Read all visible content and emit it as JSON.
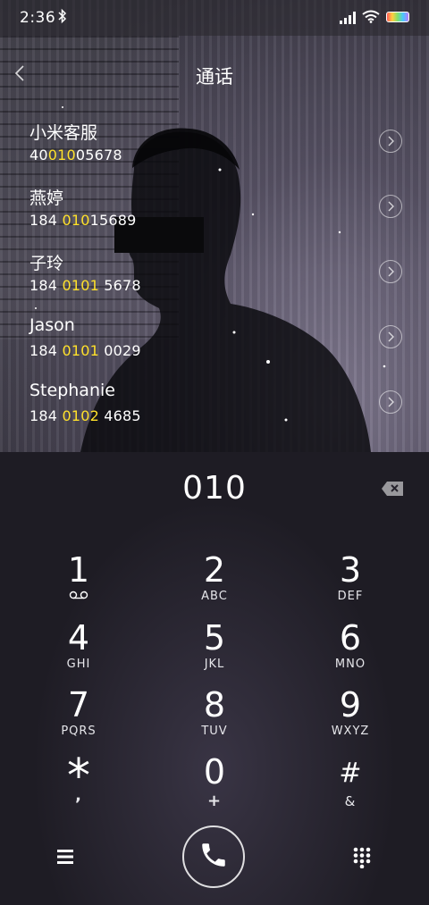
{
  "status_bar": {
    "time": "2:36"
  },
  "header": {
    "title": "通话"
  },
  "contacts": [
    {
      "name": "小米客服",
      "num_pre": "40",
      "num_hl": "010",
      "num_post": "05678"
    },
    {
      "name": "燕婷",
      "num_pre": "184 ",
      "num_hl": "010",
      "num_post": "15689"
    },
    {
      "name": "子玲",
      "num_pre": "184 ",
      "num_hl": "0101",
      "num_post": " 5678"
    },
    {
      "name": "Jason",
      "num_pre": "184 ",
      "num_hl": "0101",
      "num_post": " 0029"
    },
    {
      "name": "Stephanie",
      "num_pre": "184 ",
      "num_hl": "0102",
      "num_post": " 4685"
    }
  ],
  "dialer": {
    "input_value": "010",
    "keys": [
      {
        "digit": "1",
        "letters": ""
      },
      {
        "digit": "2",
        "letters": "ABC"
      },
      {
        "digit": "3",
        "letters": "DEF"
      },
      {
        "digit": "4",
        "letters": "GHI"
      },
      {
        "digit": "5",
        "letters": "JKL"
      },
      {
        "digit": "6",
        "letters": "MNO"
      },
      {
        "digit": "7",
        "letters": "PQRS"
      },
      {
        "digit": "8",
        "letters": "TUV"
      },
      {
        "digit": "9",
        "letters": "WXYZ"
      },
      {
        "digit": "*",
        "letters": ","
      },
      {
        "digit": "0",
        "letters": "+"
      },
      {
        "digit": "#",
        "letters": "&"
      }
    ]
  },
  "icons": {
    "bluetooth": "bluetooth-icon",
    "signal": "signal-icon",
    "wifi": "wifi-icon",
    "battery": "battery-icon",
    "back": "back-arrow-icon",
    "chevron": "chevron-right-icon",
    "delete": "backspace-icon",
    "voicemail": "voicemail-icon",
    "menu": "menu-icon",
    "call": "phone-icon",
    "keypad": "keypad-icon"
  },
  "colors": {
    "highlight": "#ffe12b"
  }
}
